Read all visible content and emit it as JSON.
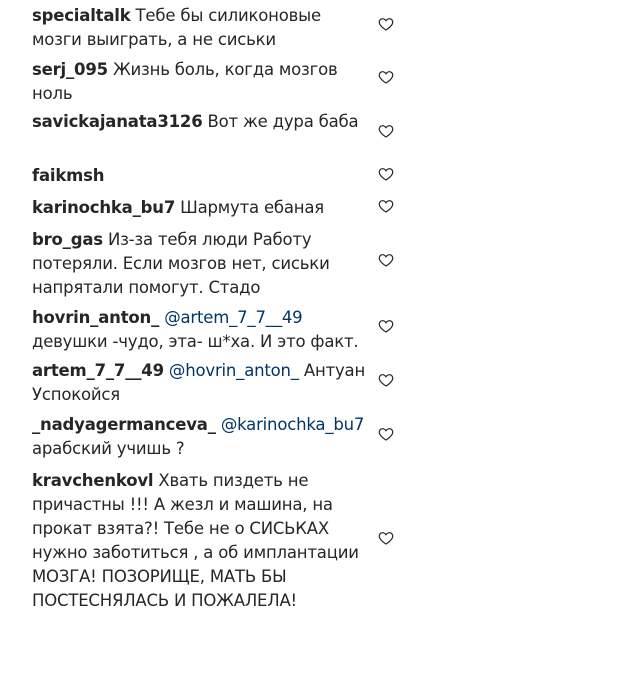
{
  "comments": [
    {
      "user": "specialtalk",
      "mention": "",
      "text": "Тебе бы силиконовые мозги выиграть, а не сиськи"
    },
    {
      "user": "serj_095",
      "mention": "",
      "text": "Жизнь боль, когда мозгов ноль"
    },
    {
      "user": "savickajanata3126",
      "mention": "",
      "text": "Вот же дура баба ￼"
    },
    {
      "user": "faikmsh",
      "mention": "",
      "text": "￼￼￼￼￼"
    },
    {
      "user": "karinochka_bu7",
      "mention": "",
      "text": "Шармута ебаная"
    },
    {
      "user": "bro_gas",
      "mention": "",
      "text": "Из-за тебя люди Работу потеряли. Если мозгов нет, сиськи напрятали помогут. Стадо"
    },
    {
      "user": "hovrin_anton_",
      "mention": "@artem_7_7__49",
      "text": "девушки -чудо, эта- ш*ха. И это факт."
    },
    {
      "user": "artem_7_7__49",
      "mention": "@hovrin_anton_",
      "text": "Антуан Успокойся ￼"
    },
    {
      "user": "_nadyagermanceva_",
      "mention": "@karinochka_bu7",
      "text": "арабский учишь ? ￼"
    },
    {
      "user": "kravchenkovl",
      "mention": "",
      "text": "Хвать пиздеть не причастны !!! А жезл и машина, на прокат взята?! Тебе не о СИСЬКАХ нужно заботиться , а об имплантации МОЗГА! ПОЗОРИЩЕ, МАТЬ БЫ ПОСТЕСНЯЛАСЬ И ПОЖАЛЕЛА!"
    }
  ],
  "icons": {
    "like": "heart-outline-icon",
    "like_color": "#262626"
  }
}
